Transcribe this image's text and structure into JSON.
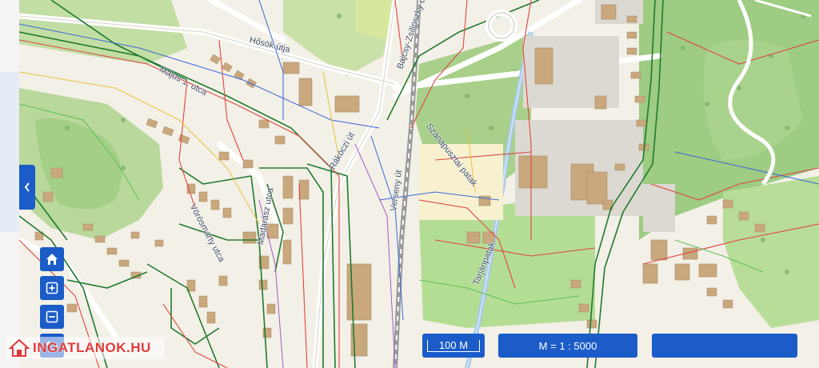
{
  "map": {
    "street_labels": [
      "Hősök útja",
      "Bajcsy-Zsilinszky út",
      "Szanapusztai patak",
      "Tarjánpatak",
      "Verseny út",
      "Május 1. utca",
      "Rákóczi út",
      "Madarász utca",
      "Vörösmarty utca"
    ]
  },
  "controls": {
    "collapse_icon": "chevron-left-icon",
    "home_icon": "home-icon",
    "zoom_in_icon": "plus-square-icon",
    "zoom_out_icon": "minus-square-icon",
    "back_icon": "undo-icon"
  },
  "scale_bar": {
    "label": "100 M"
  },
  "map_scale": {
    "label": "M = 1 : 5000"
  },
  "empty_box": {
    "label": ""
  },
  "watermark": {
    "text": "INGATLANOK.HU"
  },
  "colors": {
    "accent": "#1b5cc8",
    "watermark": "#e23a3a"
  }
}
